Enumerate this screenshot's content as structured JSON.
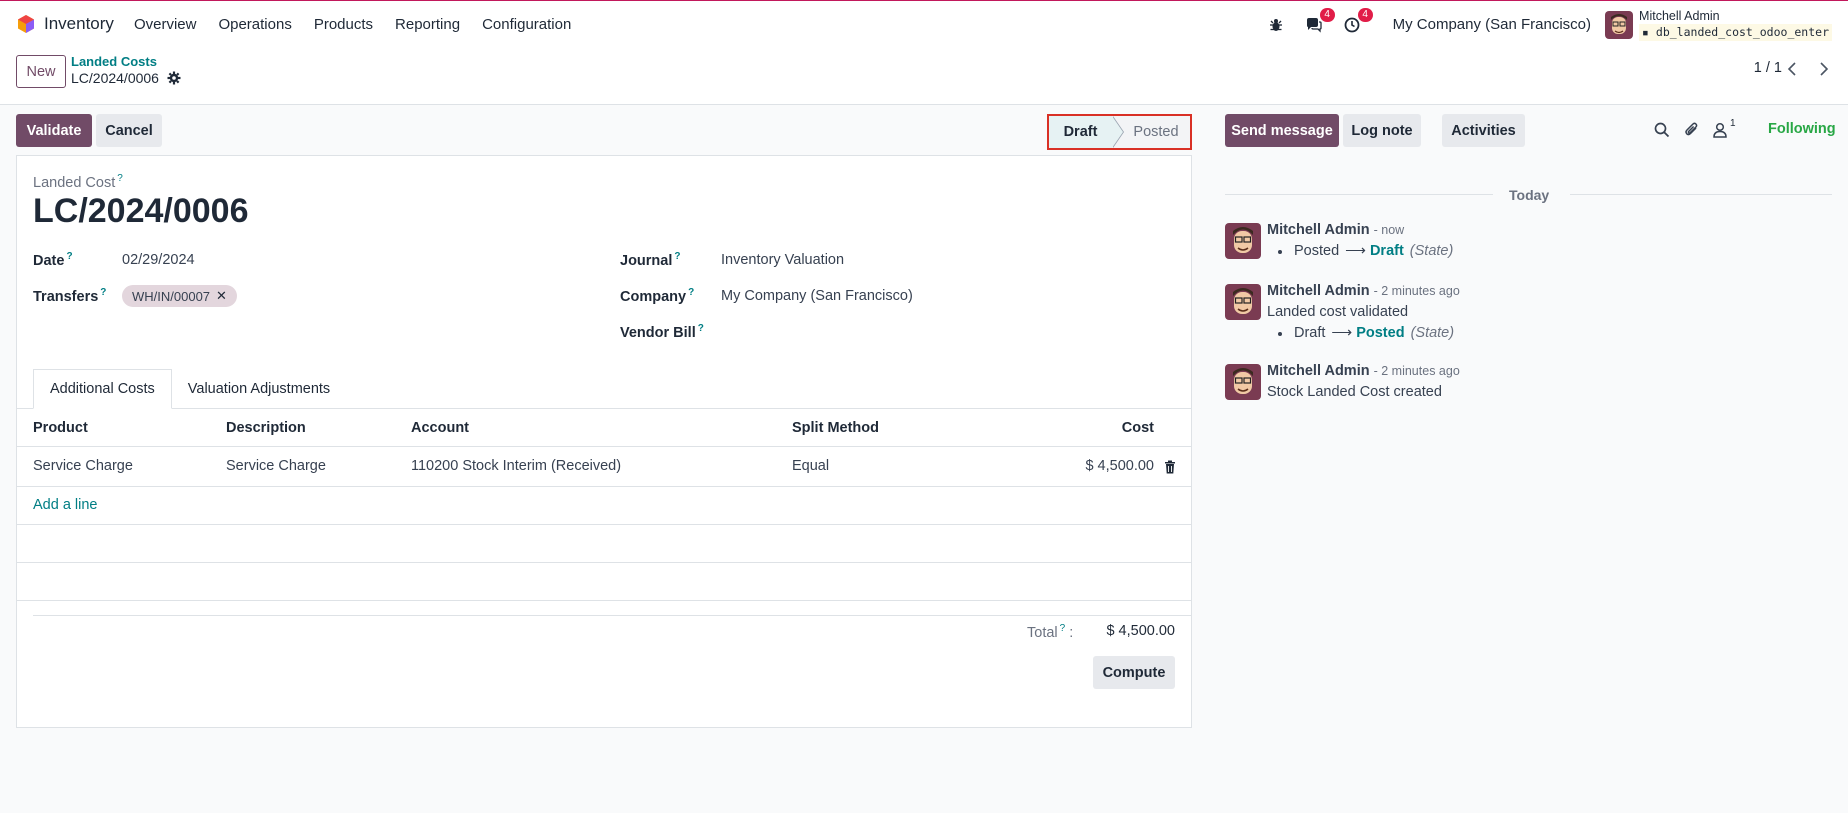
{
  "navbar": {
    "app_name": "Inventory",
    "menu": [
      "Overview",
      "Operations",
      "Products",
      "Reporting",
      "Configuration"
    ],
    "messages_badge": "4",
    "activities_badge": "4",
    "company": "My Company (San Francisco)",
    "user_name": "Mitchell Admin",
    "database": "db_landed_cost_odoo_enter"
  },
  "control_panel": {
    "new_label": "New",
    "breadcrumb_parent": "Landed Costs",
    "breadcrumb_current": "LC/2024/0006",
    "pager": "1 / 1"
  },
  "actions": {
    "validate": "Validate",
    "cancel": "Cancel"
  },
  "statusbar": {
    "draft": "Draft",
    "posted": "Posted",
    "current": "Draft"
  },
  "form": {
    "landed_cost_label": "Landed Cost",
    "name": "LC/2024/0006",
    "date_label": "Date",
    "date_value": "02/29/2024",
    "transfers_label": "Transfers",
    "transfer_tag": "WH/IN/00007",
    "journal_label": "Journal",
    "journal_value": "Inventory Valuation",
    "company_label": "Company",
    "company_value": "My Company (San Francisco)",
    "vendor_bill_label": "Vendor Bill",
    "vendor_bill_value": ""
  },
  "tabs": [
    "Additional Costs",
    "Valuation Adjustments"
  ],
  "table": {
    "headers": [
      "Product",
      "Description",
      "Account",
      "Split Method",
      "Cost"
    ],
    "rows": [
      [
        "Service Charge",
        "Service Charge",
        "110200 Stock Interim (Received)",
        "Equal",
        "$ 4,500.00"
      ]
    ],
    "add_line": "Add a line"
  },
  "totals": {
    "label": "Total",
    "value": "$ 4,500.00",
    "compute": "Compute"
  },
  "chatter": {
    "send_message": "Send message",
    "log_note": "Log note",
    "activities": "Activities",
    "followers_count": "1",
    "following": "Following",
    "today": "Today",
    "messages": [
      {
        "author": "Mitchell Admin",
        "time": "- now",
        "old": "Posted",
        "new": "Draft",
        "field": "(State)"
      },
      {
        "author": "Mitchell Admin",
        "time": "- 2 minutes ago",
        "body": "Landed cost validated",
        "old": "Draft",
        "new": "Posted",
        "field": "(State)"
      },
      {
        "author": "Mitchell Admin",
        "time": "- 2 minutes ago",
        "body": "Stock Landed Cost created"
      }
    ]
  },
  "colors": {
    "primary": "#714b67",
    "link": "#017e84",
    "following": "#28a745",
    "badge": "#e11d48"
  }
}
